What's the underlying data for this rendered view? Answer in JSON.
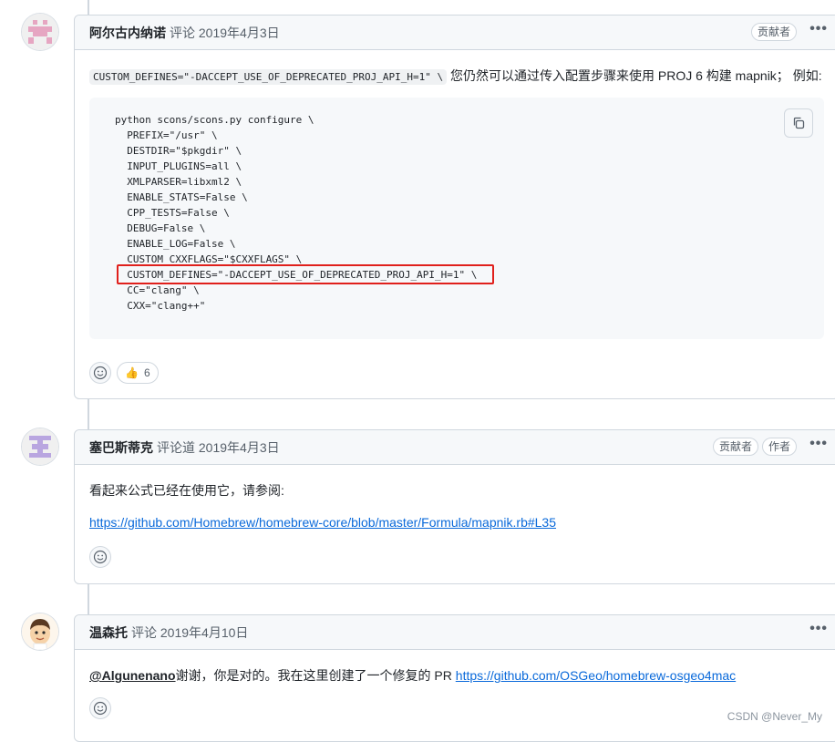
{
  "comments": [
    {
      "author": "阿尔古内纳诺",
      "meta": "评论 2019年4月3日",
      "badges": [
        "贡献者"
      ],
      "intro_code": "CUSTOM_DEFINES=\"-DACCEPT_USE_OF_DEPRECATED_PROJ_API_H=1\" \\",
      "intro_text": "您仍然可以通过传入配置步骤来使用 PROJ 6 构建 mapnik； 例如:",
      "code_lines": [
        "python scons/scons.py configure \\",
        "  PREFIX=\"/usr\" \\",
        "  DESTDIR=\"$pkgdir\" \\",
        "  INPUT_PLUGINS=all \\",
        "  XMLPARSER=libxml2 \\",
        "  ENABLE_STATS=False \\",
        "  CPP_TESTS=False \\",
        "  DEBUG=False \\",
        "  ENABLE_LOG=False \\",
        "  CUSTOM_CXXFLAGS=\"$CXXFLAGS\" \\",
        "  CUSTOM_DEFINES=\"-DACCEPT_USE_OF_DEPRECATED_PROJ_API_H=1\" \\",
        "  CC=\"clang\" \\",
        "  CXX=\"clang++\""
      ],
      "reaction_emoji": "👍",
      "reaction_count": "6"
    },
    {
      "author": "塞巴斯蒂克",
      "meta": "评论道 2019年4月3日",
      "badges": [
        "贡献者",
        "作者"
      ],
      "text": "看起来公式已经在使用它，请参阅:",
      "link": "https://github.com/Homebrew/homebrew-core/blob/master/Formula/mapnik.rb#L35"
    },
    {
      "author": "温森托",
      "meta": "评论 2019年4月10日",
      "mention": "@Algunenano",
      "text": "谢谢，你是对的。我在这里创建了一个修复的 PR ",
      "link": "https://github.com/OSGeo/homebrew-osgeo4mac"
    }
  ],
  "kebab_label": "•••",
  "watermark": "CSDN @Never_My",
  "colors": {
    "highlight": "#e0201c",
    "link": "#0969da",
    "border": "#d0d7de"
  }
}
